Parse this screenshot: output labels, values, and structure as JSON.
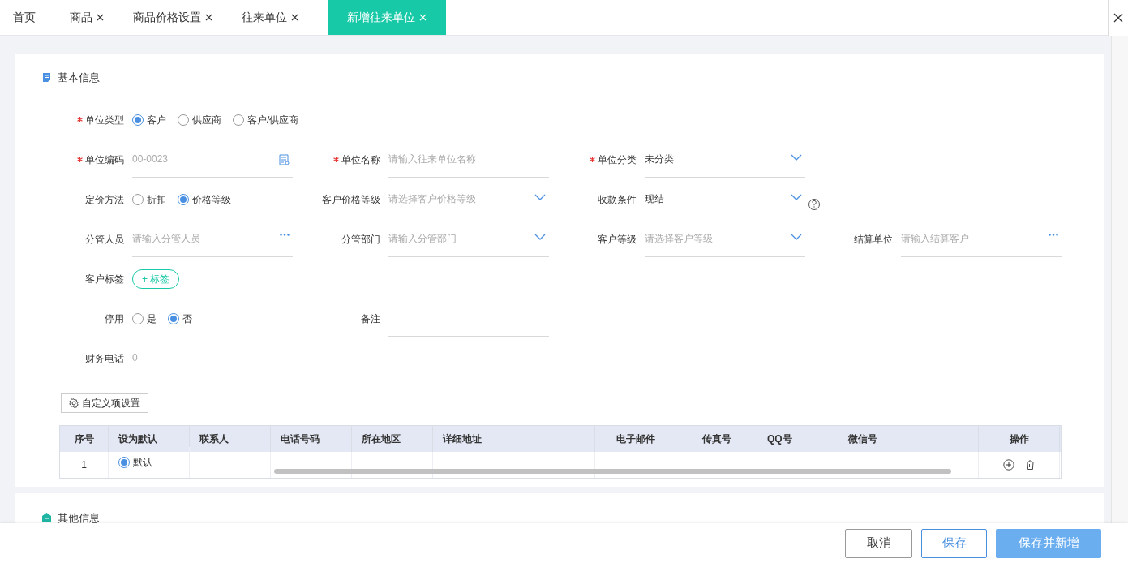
{
  "tabs": [
    {
      "label": "首页",
      "closable": false,
      "selected": false
    },
    {
      "label": "商品",
      "closable": true,
      "selected": false
    },
    {
      "label": "商品价格设置",
      "closable": true,
      "selected": false
    },
    {
      "label": "往来单位",
      "closable": true,
      "selected": false
    },
    {
      "label": "新增往来单位",
      "closable": true,
      "selected": true
    }
  ],
  "basic_info": {
    "title": "基本信息",
    "rows": [
      [
        {
          "kind": "radio",
          "label": "单位类型",
          "required": true,
          "options": [
            {
              "label": "客户",
              "selected": true
            },
            {
              "label": "供应商",
              "selected": false
            },
            {
              "label": "客户/供应商",
              "selected": false
            }
          ]
        }
      ],
      [
        {
          "kind": "input",
          "label": "单位编码",
          "required": true,
          "placeholder": "00-0023",
          "suffix": {
            "kind": "doc"
          }
        },
        {
          "kind": "input",
          "label": "单位名称",
          "required": true,
          "placeholder": "请输入往来单位名称"
        },
        {
          "kind": "input",
          "label": "单位分类",
          "required": true,
          "value": "未分类",
          "suffix": {
            "kind": "chevron"
          }
        }
      ],
      [
        {
          "kind": "radio",
          "label": "定价方法",
          "required": false,
          "options": [
            {
              "label": "折扣",
              "selected": false
            },
            {
              "label": "价格等级",
              "selected": true
            }
          ]
        },
        {
          "kind": "input",
          "label": "客户价格等级",
          "required": false,
          "placeholder": "请选择客户价格等级",
          "suffix": {
            "kind": "chevron"
          }
        },
        {
          "kind": "input",
          "label": "收款条件",
          "required": false,
          "value": "现结",
          "suffix": {
            "kind": "chevron"
          },
          "help": true
        }
      ],
      [
        {
          "kind": "input",
          "label": "分管人员",
          "required": false,
          "placeholder": "请输入分管人员",
          "suffix": {
            "kind": "ellipsis"
          }
        },
        {
          "kind": "input",
          "label": "分管部门",
          "required": false,
          "placeholder": "请输入分管部门",
          "suffix": {
            "kind": "chevron"
          }
        },
        {
          "kind": "input",
          "label": "客户等级",
          "required": false,
          "placeholder": "请选择客户等级",
          "suffix": {
            "kind": "chevron"
          }
        },
        {
          "kind": "input",
          "label": "结算单位",
          "required": false,
          "placeholder": "请输入结算客户",
          "suffix": {
            "kind": "ellipsis"
          }
        }
      ],
      [
        {
          "kind": "tag",
          "label": "客户标签",
          "required": false,
          "button": "+ 标签"
        }
      ],
      [
        {
          "kind": "radio",
          "label": "停用",
          "required": false,
          "options": [
            {
              "label": "是",
              "selected": false
            },
            {
              "label": "否",
              "selected": true
            }
          ]
        },
        {
          "kind": "input",
          "label": "备注",
          "required": false
        }
      ],
      [
        {
          "kind": "input",
          "label": "财务电话",
          "required": false,
          "placeholder": "0"
        }
      ]
    ],
    "custom_button": "自定义项设置"
  },
  "contacts_table": {
    "columns": [
      "序号",
      "设为默认",
      "联系人",
      "电话号码",
      "所在地区",
      "详细地址",
      "电子邮件",
      "传真号",
      "QQ号",
      "微信号",
      "操作"
    ],
    "rows": [
      {
        "index": "1",
        "default": {
          "label": "默认",
          "selected": true
        }
      }
    ]
  },
  "other_info": {
    "title": "其他信息"
  },
  "footer_buttons": [
    {
      "label": "取消",
      "kind": "plain"
    },
    {
      "label": "保存",
      "kind": "outline"
    },
    {
      "label": "保存并新增",
      "kind": "primary"
    }
  ]
}
